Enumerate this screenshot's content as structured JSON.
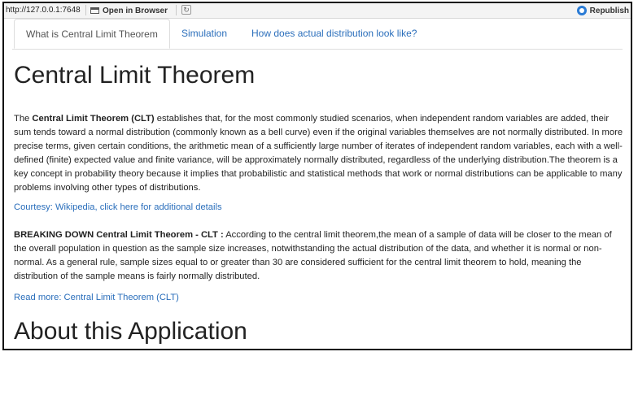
{
  "toolbar": {
    "url": "http://127.0.0.1:7648",
    "open_in_browser": "Open in Browser",
    "republish": "Republish"
  },
  "tabs": [
    {
      "label": "What is Central Limit Theorem",
      "active": true
    },
    {
      "label": "Simulation",
      "active": false
    },
    {
      "label": "How does actual distribution look like?",
      "active": false
    }
  ],
  "main": {
    "title": "Central Limit Theorem",
    "intro_prefix": "The ",
    "intro_bold": "Central Limit Theorem (CLT)",
    "intro_text": " establishes that, for the most commonly studied scenarios, when independent random variables are added, their sum tends toward a normal distribution (commonly known as a bell curve) even if the original variables themselves are not normally distributed. In more precise terms, given certain conditions, the arithmetic mean of a sufficiently large number of iterates of independent random variables, each with a well-defined (finite) expected value and finite variance, will be approximately normally distributed, regardless of the underlying distribution.The theorem is a key concept in probability theory because it implies that probabilistic and statistical methods that work or normal distributions can be applicable to many problems involving other types of distributions.",
    "courtesy_link": "Courtesy: Wikipedia, click here for additional details",
    "breakdown_bold": "BREAKING DOWN Central Limit Theorem - CLT :",
    "breakdown_text": " According to the central limit theorem,the mean of a sample of data will be closer to the mean of the overall population in question as the sample size increases, notwithstanding the actual distribution of the data, and whether it is normal or non-normal. As a general rule, sample sizes equal to or greater than 30 are considered sufficient for the central limit theorem to hold, meaning the distribution of the sample means is fairly normally distributed.",
    "read_more_link": "Read more: Central Limit Theorem (CLT)",
    "about_title": "About this Application"
  },
  "colors": {
    "link": "#2a6ebb",
    "text": "#222222",
    "border": "#111111"
  }
}
